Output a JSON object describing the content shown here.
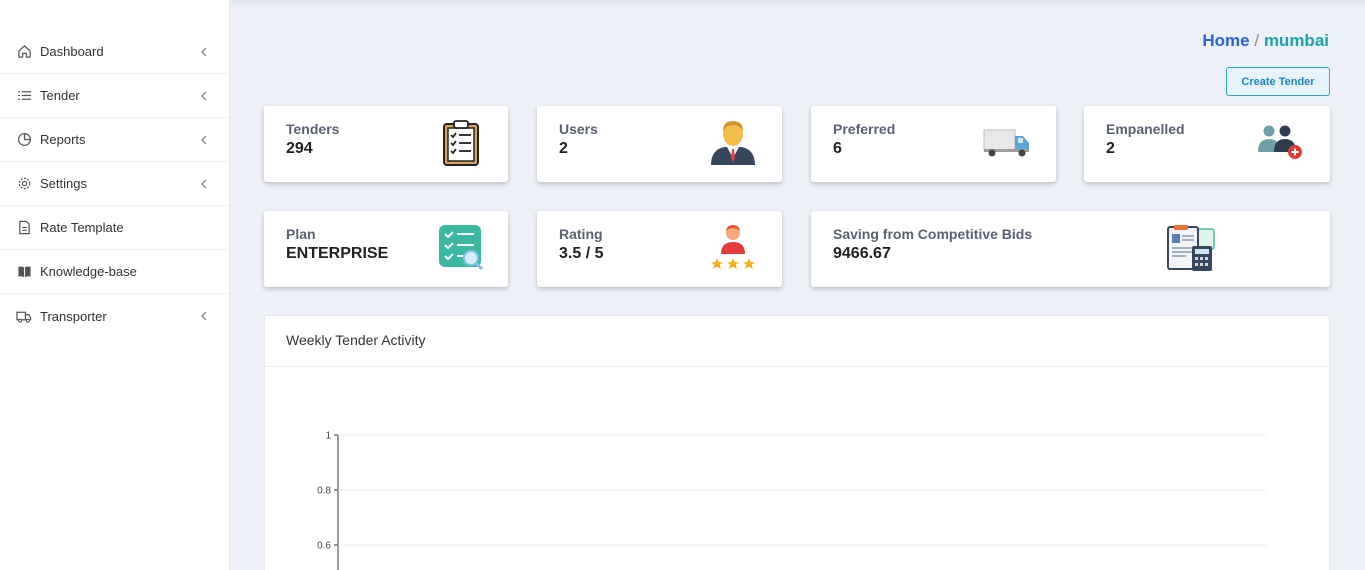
{
  "sidebar": {
    "items": [
      {
        "label": "Dashboard",
        "icon": "home-icon",
        "chevron": true
      },
      {
        "label": "Tender",
        "icon": "list-icon",
        "chevron": true
      },
      {
        "label": "Reports",
        "icon": "pie-chart-icon",
        "chevron": true
      },
      {
        "label": "Settings",
        "icon": "gear-icon",
        "chevron": true
      },
      {
        "label": "Rate Template",
        "icon": "document-icon",
        "chevron": false
      },
      {
        "label": "Knowledge-base",
        "icon": "book-icon",
        "chevron": false
      },
      {
        "label": "Transporter",
        "icon": "truck-icon",
        "chevron": true
      }
    ]
  },
  "breadcrumb": {
    "home": "Home",
    "separator": "/",
    "current": "mumbai"
  },
  "create_tender_label": "Create Tender",
  "stats": {
    "tenders": {
      "label": "Tenders",
      "value": "294"
    },
    "users": {
      "label": "Users",
      "value": "2"
    },
    "preferred": {
      "label": "Preferred",
      "value": "6"
    },
    "empanelled": {
      "label": "Empanelled",
      "value": "2"
    },
    "plan": {
      "label": "Plan",
      "value": "ENTERPRISE"
    },
    "rating": {
      "label": "Rating",
      "value": "3.5 / 5"
    },
    "saving": {
      "label": "Saving from Competitive Bids",
      "value": "9466.67"
    }
  },
  "chart": {
    "title": "Weekly Tender Activity"
  },
  "chart_data": {
    "type": "line",
    "title": "Weekly Tender Activity",
    "xlabel": "",
    "ylabel": "",
    "ylim": [
      0,
      1
    ],
    "yticks": [
      "1",
      "0.8",
      "0.6"
    ],
    "grid": true,
    "series": []
  },
  "colors": {
    "accent": "#2b63d9",
    "teal": "#1ba3a8",
    "button_border": "#2ea6d6"
  }
}
